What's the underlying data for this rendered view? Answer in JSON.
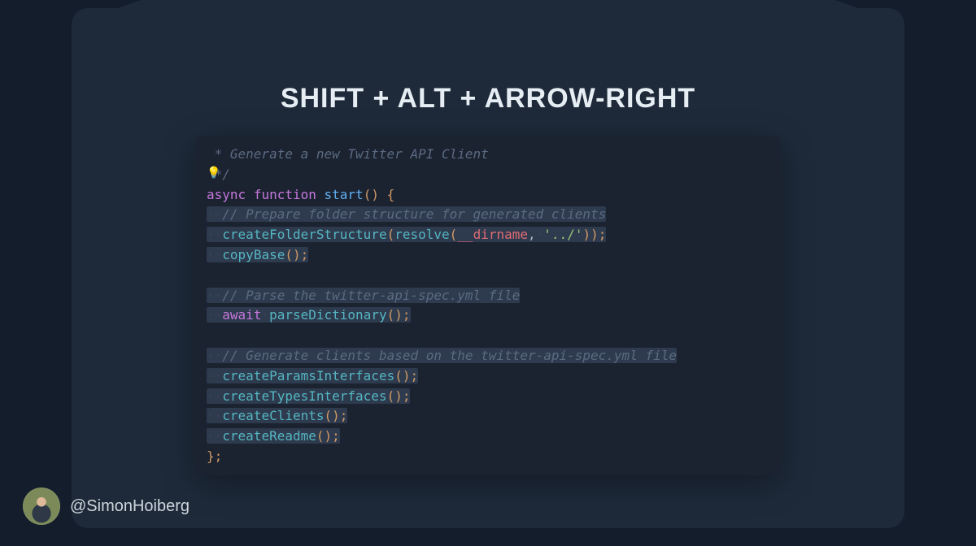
{
  "title": "Shift + Alt + Arrow-Right",
  "footer": {
    "handle": "@SimonHoiberg"
  },
  "code": {
    "l1_comment": " * Generate a new Twitter API Client",
    "l2_bulb": "💡",
    "l2_close": "*/",
    "l3_kw_async": "async",
    "l3_kw_function": "function",
    "l3_fn": "start",
    "l3_parens": "()",
    "l3_brace": " {",
    "l4_comment": "// Prepare folder structure for generated clients",
    "l5_fn": "createFolderStructure",
    "l5_open": "(",
    "l5_inner": "resolve",
    "l5_iopen": "(",
    "l5_var": "__dirname",
    "l5_comma": ",",
    "l5_str": "'../'",
    "l5_iclose": ")",
    "l5_close": ");",
    "l6_fn": "copyBase",
    "l6_tail": "();",
    "l8_comment": "// Parse the twitter-api-spec.yml file",
    "l9_kw": "await",
    "l9_fn": "parseDictionary",
    "l9_tail": "();",
    "l11_comment": "// Generate clients based on the twitter-api-spec.yml file",
    "l12_fn": "createParamsInterfaces",
    "l12_tail": "();",
    "l13_fn": "createTypesInterfaces",
    "l13_tail": "();",
    "l14_fn": "createClients",
    "l14_tail": "();",
    "l15_fn": "createReadme",
    "l15_tail": "();",
    "l16_close": "};",
    "dot": "·",
    "sp": " "
  }
}
